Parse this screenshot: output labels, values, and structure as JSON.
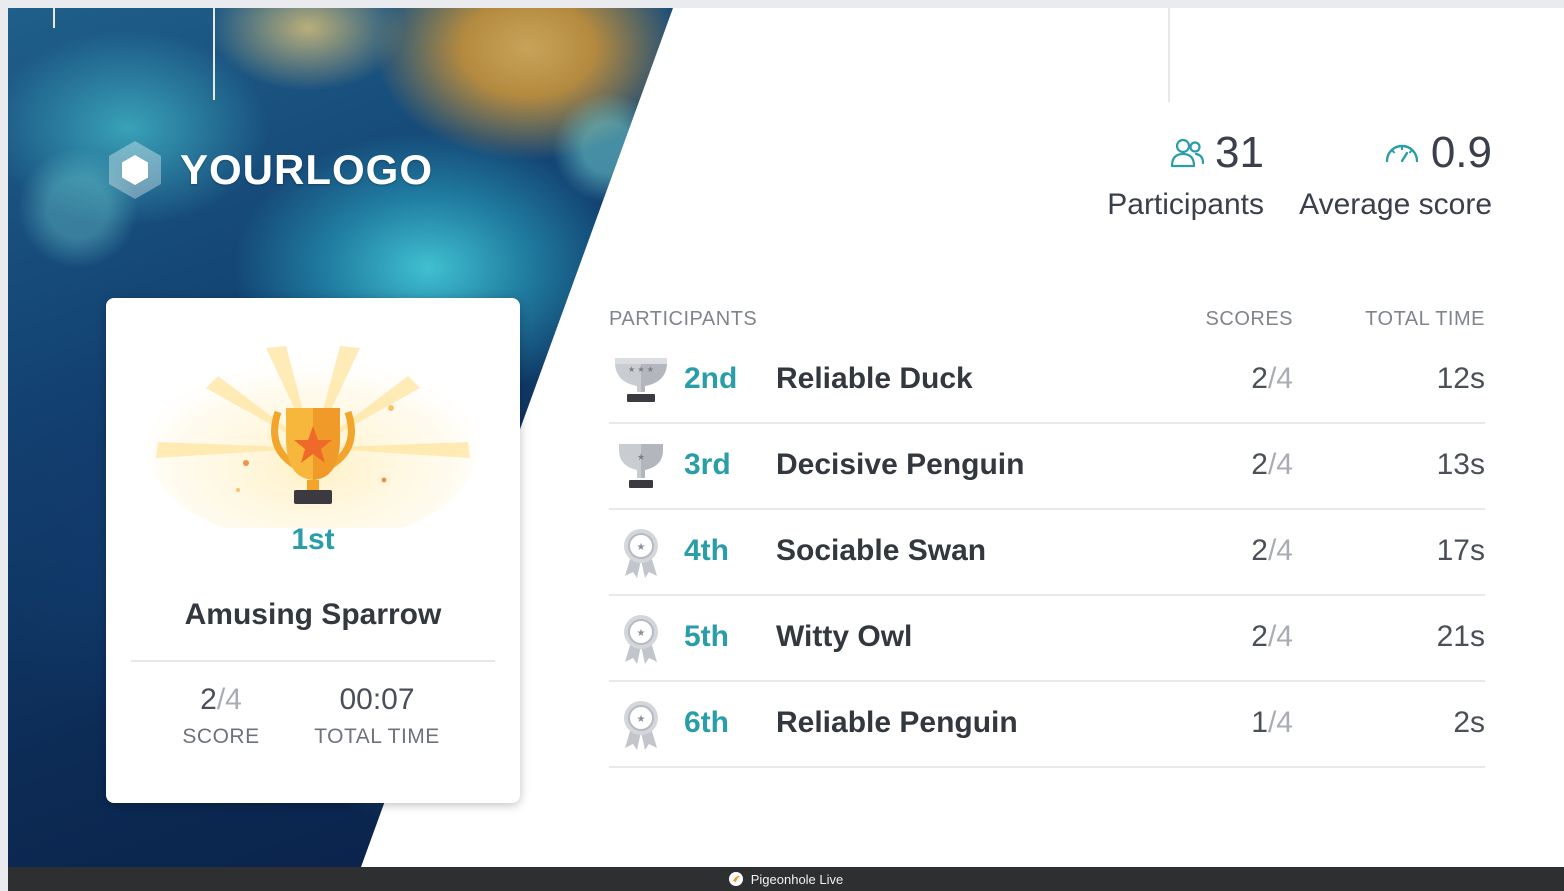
{
  "brand": {
    "logo_text": "YOURLOGO",
    "accent": "#2a9ea8"
  },
  "winner": {
    "rank": "1st",
    "name": "Amusing Sparrow",
    "score": "2",
    "score_total": "/4",
    "score_label": "SCORE",
    "time": "00:07",
    "time_label": "TOTAL TIME",
    "icon": "gold-trophy-icon"
  },
  "summary": {
    "participants_count": "31",
    "participants_label": "Participants",
    "participants_icon": "users-icon",
    "average_score": "0.9",
    "average_label": "Average score",
    "average_icon": "gauge-icon"
  },
  "leaderboard": {
    "headers": {
      "participants": "PARTICIPANTS",
      "scores": "SCORES",
      "total_time": "TOTAL TIME"
    },
    "rows": [
      {
        "rank": "2nd",
        "name": "Reliable Duck",
        "score": "2",
        "score_total": "/4",
        "time": "12s",
        "icon": "silver-trophy-icon"
      },
      {
        "rank": "3rd",
        "name": "Decisive Penguin",
        "score": "2",
        "score_total": "/4",
        "time": "13s",
        "icon": "bronze-trophy-icon"
      },
      {
        "rank": "4th",
        "name": "Sociable Swan",
        "score": "2",
        "score_total": "/4",
        "time": "17s",
        "icon": "medal-icon"
      },
      {
        "rank": "5th",
        "name": "Witty Owl",
        "score": "2",
        "score_total": "/4",
        "time": "21s",
        "icon": "medal-icon"
      },
      {
        "rank": "6th",
        "name": "Reliable Penguin",
        "score": "1",
        "score_total": "/4",
        "time": "2s",
        "icon": "medal-icon"
      }
    ]
  },
  "footer": {
    "label": "Pigeonhole Live",
    "icon": "pigeonhole-logo-icon"
  }
}
